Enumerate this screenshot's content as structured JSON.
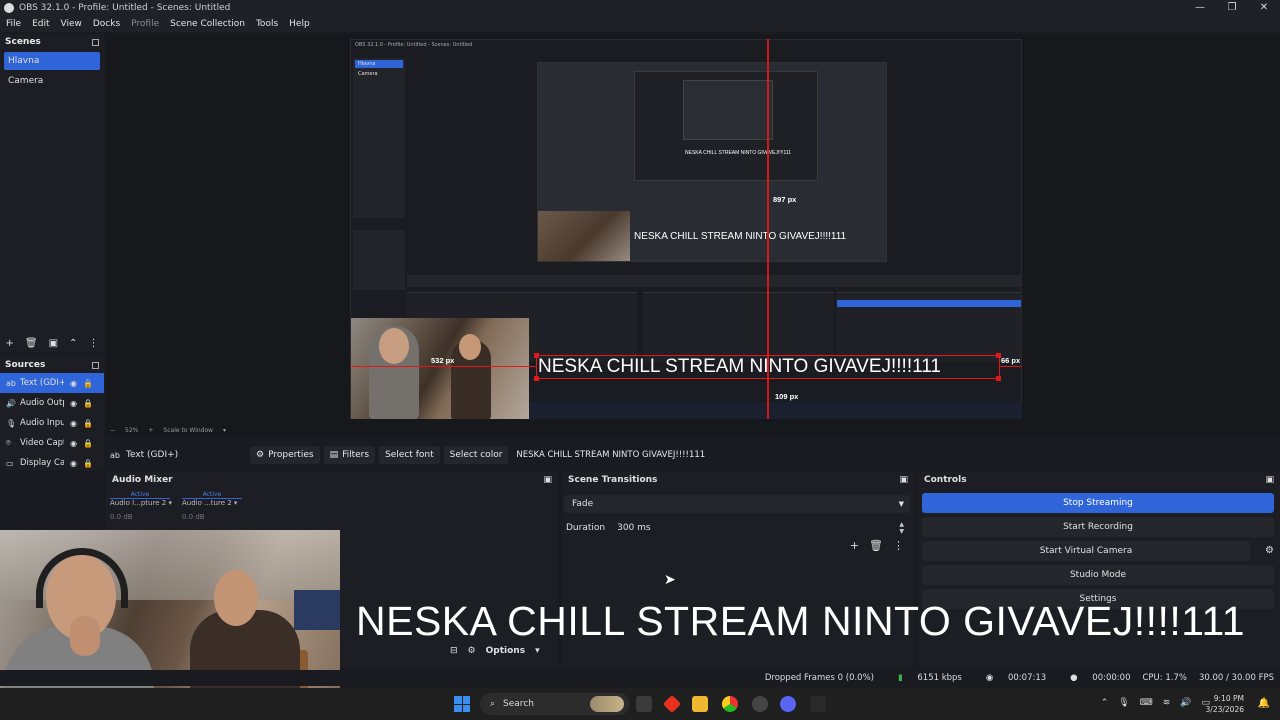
{
  "window": {
    "title": "OBS 32.1.0 - Profile: Untitled - Scenes: Untitled",
    "controls": [
      "—",
      "❐",
      "✕"
    ]
  },
  "menu": [
    "File",
    "Edit",
    "View",
    "Docks",
    "Profile",
    "Scene Collection",
    "Tools",
    "Help"
  ],
  "scenes": {
    "title": "Scenes",
    "items": [
      "Hlavna",
      "Camera"
    ]
  },
  "sources": {
    "title": "Sources",
    "items": [
      "Text (GDI+)",
      "Audio Output Capture",
      "Audio Input Capture",
      "Video Capture Device",
      "Display Capture"
    ]
  },
  "preview": {
    "nested_title": "OBS 32.1.0 - Profile: Untitled - Scenes: Untitled",
    "overlay_text": "NESKA CHILL STREAM NINTO GIVAVEJ!!!!111",
    "label_897": "897 px",
    "label_532": "532 px",
    "label_66": "66 px",
    "label_109": "109 px",
    "zoom": "52%",
    "scale": "Scale to Window"
  },
  "context_bar": {
    "source": "Text (GDI+)",
    "properties": "Properties",
    "filters": "Filters",
    "select_font": "Select font",
    "select_color": "Select color",
    "text_value": "NESKA CHILL STREAM NINTO GIVAVEJ!!!!111"
  },
  "audio_mixer": {
    "title": "Audio Mixer",
    "channels": [
      {
        "active": "Active",
        "name": "Audio I...pture 2",
        "db": "0.0 dB"
      },
      {
        "active": "Active",
        "name": "Audio ...ture 2",
        "db": "0.0 dB"
      }
    ],
    "options": "Options"
  },
  "scene_transitions": {
    "title": "Scene Transitions",
    "transition": "Fade",
    "duration_label": "Duration",
    "duration_value": "300 ms"
  },
  "controls": {
    "title": "Controls",
    "stop_streaming": "Stop Streaming",
    "start_recording": "Start Recording",
    "start_virtual_camera": "Start Virtual Camera",
    "studio_mode": "Studio Mode",
    "settings": "Settings"
  },
  "overlay_text": "NESKA CHILL STREAM NINTO GIVAVEJ!!!!111",
  "statusbar": {
    "dropped_frames": "Dropped Frames 0 (0.0%)",
    "bitrate": "6151 kbps",
    "stream_time": "00:07:13",
    "rec_time": "00:00:00",
    "cpu": "CPU: 1.7%",
    "fps": "30.00 / 30.00 FPS"
  },
  "taskbar": {
    "search": "Search",
    "time": "9:10 PM",
    "date": "3/23/2026"
  },
  "colors": {
    "accent": "#2f65d8",
    "red_guide": "#e01a1a",
    "bitrate_green": "#3bb24a"
  }
}
